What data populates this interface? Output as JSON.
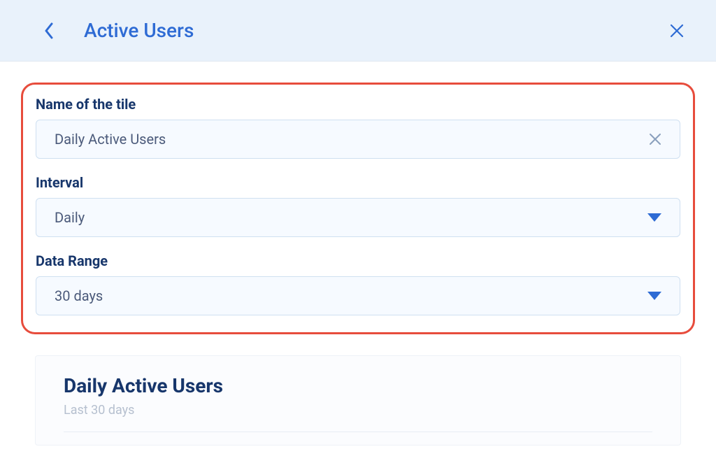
{
  "header": {
    "title": "Active Users"
  },
  "form": {
    "tile_name": {
      "label": "Name of the tile",
      "value": "Daily Active Users"
    },
    "interval": {
      "label": "Interval",
      "value": "Daily"
    },
    "data_range": {
      "label": "Data Range",
      "value": "30 days"
    }
  },
  "preview": {
    "title": "Daily Active Users",
    "subtitle": "Last 30 days"
  },
  "colors": {
    "primary_blue": "#2e6bd4",
    "dark_navy": "#17366b",
    "highlight_red": "#e74c3c",
    "header_bg": "#e9f2fb",
    "field_bg": "#f6faff"
  }
}
